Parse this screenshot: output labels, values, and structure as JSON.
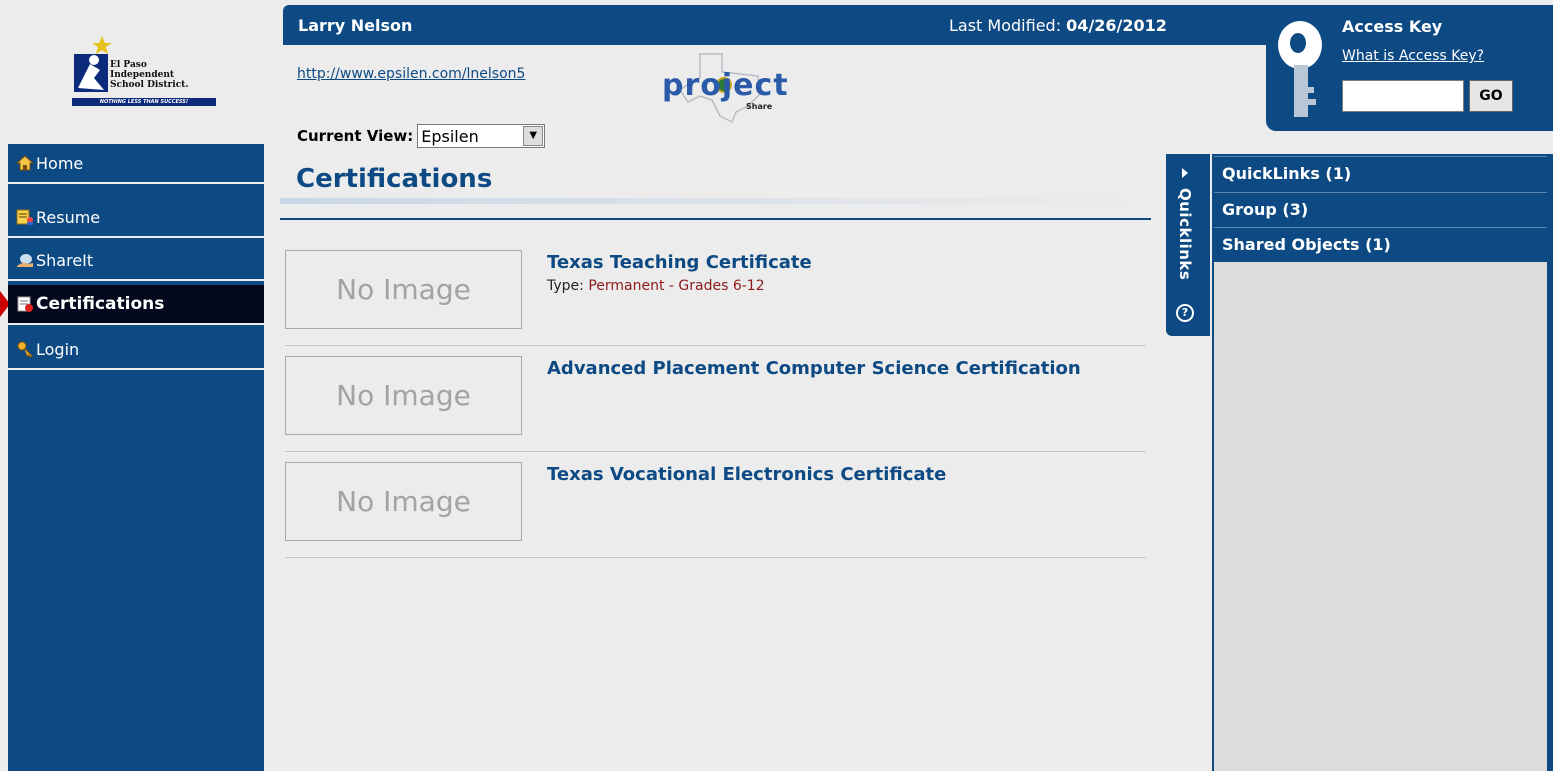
{
  "logo": {
    "lines": [
      "El Paso",
      "Independent",
      "School District."
    ],
    "tagline": "NOTHING LESS THAN SUCCESS!"
  },
  "sidebar": {
    "items": [
      {
        "label": "Home",
        "icon": "home-icon"
      },
      {
        "label": "Resume",
        "icon": "resume-icon"
      },
      {
        "label": "ShareIt",
        "icon": "share-icon"
      },
      {
        "label": "Certifications",
        "icon": "certificate-icon",
        "active": true
      },
      {
        "label": "Login",
        "icon": "key-icon"
      }
    ]
  },
  "header": {
    "user_name": "Larry Nelson",
    "last_modified_label": "Last Modified:",
    "last_modified_date": "04/26/2012",
    "profile_url": "http://www.epsilen.com/lnelson5"
  },
  "project_logo": {
    "word": "project",
    "sub": "Share"
  },
  "access_key": {
    "title": "Access Key",
    "help_link": "What is Access Key?",
    "input_value": "",
    "go_label": "GO"
  },
  "current_view": {
    "label": "Current View:",
    "selected": "Epsilen"
  },
  "page": {
    "title": "Certifications"
  },
  "certifications": [
    {
      "thumb": "No Image",
      "title": "Texas Teaching Certificate",
      "type_label": "Type:",
      "type_value": "Permanent - Grades 6-12"
    },
    {
      "thumb": "No Image",
      "title": "Advanced Placement Computer Science Certification",
      "type_label": "",
      "type_value": ""
    },
    {
      "thumb": "No Image",
      "title": "Texas Vocational Electronics Certificate",
      "type_label": "",
      "type_value": ""
    }
  ],
  "quicklinks": {
    "tab_label": "Quicklinks",
    "help_symbol": "?",
    "items": [
      {
        "label": "QuickLinks (1)"
      },
      {
        "label": "Group (3)"
      },
      {
        "label": "Shared Objects (1)"
      }
    ]
  },
  "colors": {
    "brand_blue": "#0d4a84",
    "active_nav": "#04081c",
    "type_value": "#8c1a1a"
  }
}
